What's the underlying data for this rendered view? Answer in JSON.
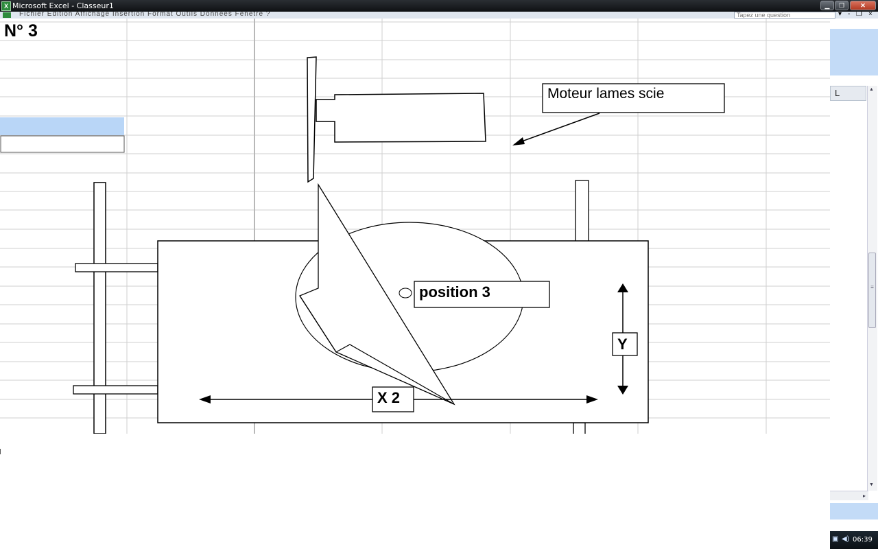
{
  "window": {
    "title": "Microsoft Excel - Classeur1",
    "min_label": "▁",
    "max_label": "❐",
    "close_label": "✕",
    "app_icon": "X"
  },
  "menubar": {
    "menu_text": "Fichier   Edition   Affichage   Insertion   Format   Outils   Données   Fenêtre   ?",
    "help_placeholder": "Tapez une question",
    "doc_min": "-",
    "doc_restore": "❐",
    "doc_close": "×"
  },
  "sheet": {
    "heading": "N° 3",
    "column_header_visible": "L"
  },
  "drawing": {
    "motor_label": "Moteur lames scie",
    "position_label": "position 3",
    "x_label": "X 2",
    "y_label": "Y"
  },
  "scrollbar": {
    "thumb_grip": "≡",
    "up_arrow": "▲",
    "down_arrow": "▼",
    "h_arrow": "▸"
  },
  "tray": {
    "clock": "06:39",
    "speaker_icon": "speaker-icon",
    "network_icon": "network-icon"
  },
  "colors": {
    "grid": "#c8c8c8",
    "selection": "#b9d6f7",
    "titlebar": "#121519"
  }
}
